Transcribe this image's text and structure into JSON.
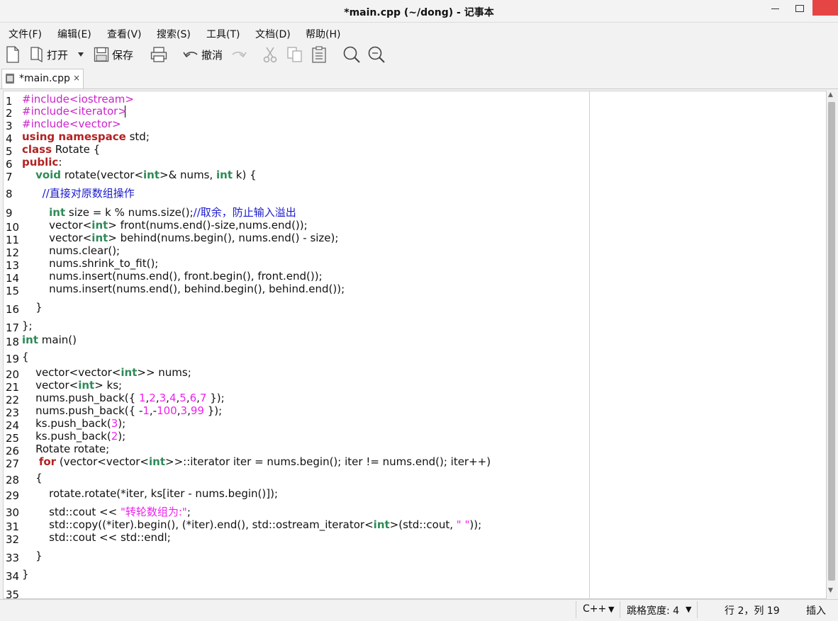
{
  "window": {
    "title": "*main.cpp (~/dong) - 记事本"
  },
  "menu": [
    "文件(F)",
    "编辑(E)",
    "查看(V)",
    "搜索(S)",
    "工具(T)",
    "文档(D)",
    "帮助(H)"
  ],
  "toolbar": {
    "open_label": "打开",
    "save_label": "保存",
    "undo_label": "撤消"
  },
  "tab": {
    "label": "*main.cpp",
    "close": "×"
  },
  "editor": {
    "lines": [
      {
        "n": "1",
        "segs": [
          [
            "pp",
            "#include<iostream>"
          ]
        ]
      },
      {
        "n": "2",
        "segs": [
          [
            "pp",
            "#include<iterator>"
          ]
        ]
      },
      {
        "n": "3",
        "segs": [
          [
            "pp",
            "#include<vector>"
          ]
        ]
      },
      {
        "n": "4",
        "segs": [
          [
            "kw",
            "using namespace"
          ],
          [
            "p",
            " std;"
          ]
        ]
      },
      {
        "n": "5",
        "segs": [
          [
            "kw",
            "class"
          ],
          [
            "p",
            " Rotate {"
          ]
        ]
      },
      {
        "n": "6",
        "segs": [
          [
            "kw",
            "public"
          ],
          [
            "p",
            ":"
          ]
        ]
      },
      {
        "n": "7",
        "segs": [
          [
            "p",
            "    "
          ],
          [
            "ty",
            "void"
          ],
          [
            "p",
            " rotate(vector<"
          ],
          [
            "ty",
            "int"
          ],
          [
            "p",
            ">& nums, "
          ],
          [
            "ty",
            "int"
          ],
          [
            "p",
            " k) {"
          ]
        ]
      },
      {
        "n": "8",
        "segs": [
          [
            "p",
            "      "
          ],
          [
            "cm",
            "//直接对原数组操作"
          ]
        ]
      },
      {
        "n": "9",
        "segs": [
          [
            "p",
            "        "
          ],
          [
            "ty",
            "int"
          ],
          [
            "p",
            " size = k % nums.size();"
          ],
          [
            "cm",
            "//取余，防止输入溢出"
          ]
        ]
      },
      {
        "n": "10",
        "segs": [
          [
            "p",
            "        vector<"
          ],
          [
            "ty",
            "int"
          ],
          [
            "p",
            "> front(nums.end()-size,nums.end());"
          ]
        ]
      },
      {
        "n": "11",
        "segs": [
          [
            "p",
            "        vector<"
          ],
          [
            "ty",
            "int"
          ],
          [
            "p",
            "> behind(nums.begin(), nums.end() - size);"
          ]
        ]
      },
      {
        "n": "12",
        "segs": [
          [
            "p",
            "        nums.clear();"
          ]
        ]
      },
      {
        "n": "13",
        "segs": [
          [
            "p",
            "        nums.shrink_to_fit();"
          ]
        ]
      },
      {
        "n": "14",
        "segs": [
          [
            "p",
            "        nums.insert(nums.end(), front.begin(), front.end());"
          ]
        ]
      },
      {
        "n": "15",
        "segs": [
          [
            "p",
            "        nums.insert(nums.end(), behind.begin(), behind.end());"
          ]
        ]
      },
      {
        "n": "16",
        "segs": [
          [
            "p",
            "    }"
          ]
        ]
      },
      {
        "n": "17",
        "segs": [
          [
            "p",
            "};"
          ]
        ]
      },
      {
        "n": "18",
        "segs": [
          [
            "ty",
            "int"
          ],
          [
            "p",
            " main()"
          ]
        ]
      },
      {
        "n": "19",
        "segs": [
          [
            "p",
            "{"
          ]
        ]
      },
      {
        "n": "20",
        "segs": [
          [
            "p",
            "    vector<vector<"
          ],
          [
            "ty",
            "int"
          ],
          [
            "p",
            ">> nums;"
          ]
        ]
      },
      {
        "n": "21",
        "segs": [
          [
            "p",
            "    vector<"
          ],
          [
            "ty",
            "int"
          ],
          [
            "p",
            "> ks;"
          ]
        ]
      },
      {
        "n": "22",
        "segs": [
          [
            "p",
            "    nums.push_back({ "
          ],
          [
            "nm",
            "1"
          ],
          [
            "p",
            ","
          ],
          [
            "nm",
            "2"
          ],
          [
            "p",
            ","
          ],
          [
            "nm",
            "3"
          ],
          [
            "p",
            ","
          ],
          [
            "nm",
            "4"
          ],
          [
            "p",
            ","
          ],
          [
            "nm",
            "5"
          ],
          [
            "p",
            ","
          ],
          [
            "nm",
            "6"
          ],
          [
            "p",
            ","
          ],
          [
            "nm",
            "7"
          ],
          [
            "p",
            " });"
          ]
        ]
      },
      {
        "n": "23",
        "segs": [
          [
            "p",
            "    nums.push_back({ -"
          ],
          [
            "nm",
            "1"
          ],
          [
            "p",
            ",-"
          ],
          [
            "nm",
            "100"
          ],
          [
            "p",
            ","
          ],
          [
            "nm",
            "3"
          ],
          [
            "p",
            ","
          ],
          [
            "nm",
            "99"
          ],
          [
            "p",
            " });"
          ]
        ]
      },
      {
        "n": "24",
        "segs": [
          [
            "p",
            "    ks.push_back("
          ],
          [
            "nm",
            "3"
          ],
          [
            "p",
            ");"
          ]
        ]
      },
      {
        "n": "25",
        "segs": [
          [
            "p",
            "    ks.push_back("
          ],
          [
            "nm",
            "2"
          ],
          [
            "p",
            ");"
          ]
        ]
      },
      {
        "n": "26",
        "segs": [
          [
            "p",
            "    Rotate rotate;"
          ]
        ]
      },
      {
        "n": "27",
        "segs": [
          [
            "p",
            "     "
          ],
          [
            "kw",
            "for"
          ],
          [
            "p",
            " (vector<vector<"
          ],
          [
            "ty",
            "int"
          ],
          [
            "p",
            ">>::iterator iter = nums.begin(); iter != nums.end(); iter++)"
          ]
        ]
      },
      {
        "n": "28",
        "segs": [
          [
            "p",
            "    {"
          ]
        ]
      },
      {
        "n": "29",
        "segs": [
          [
            "p",
            "        rotate.rotate(*iter, ks[iter - nums.begin()]);"
          ]
        ]
      },
      {
        "n": "30",
        "segs": [
          [
            "p",
            "        std::cout << "
          ],
          [
            "st",
            "\"转轮数组为:\""
          ],
          [
            "p",
            ";"
          ]
        ]
      },
      {
        "n": "31",
        "segs": [
          [
            "p",
            "        std::copy((*iter).begin(), (*iter).end(), std::ostream_iterator<"
          ],
          [
            "ty",
            "int"
          ],
          [
            "p",
            ">(std::cout, "
          ],
          [
            "st",
            "\" \""
          ],
          [
            "p",
            "));"
          ]
        ]
      },
      {
        "n": "32",
        "segs": [
          [
            "p",
            "        std::cout << std::endl;"
          ]
        ]
      },
      {
        "n": "33",
        "segs": [
          [
            "p",
            "    }"
          ]
        ]
      },
      {
        "n": "34",
        "segs": [
          [
            "p",
            "}"
          ]
        ]
      },
      {
        "n": "35",
        "segs": []
      }
    ]
  },
  "status": {
    "language": "C++",
    "tab_width": "跳格宽度: 4",
    "position": "行 2，列 19",
    "mode": "插入"
  },
  "colors": {
    "pp": "#cc22cc",
    "kw": "#b22222",
    "ty": "#2e8b57",
    "cm": "#1a1acc",
    "nm": "#ee22ee",
    "st": "#ee22ee",
    "p": "#111111"
  }
}
